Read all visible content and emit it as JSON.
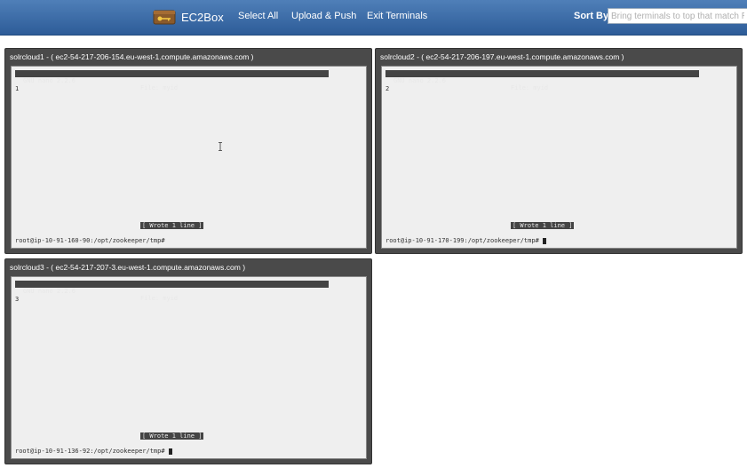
{
  "app": {
    "name": "EC2Box",
    "icon": "key-chest-icon"
  },
  "nav": {
    "select_all": "Select All",
    "upload_push": "Upload & Push",
    "exit_terminals": "Exit Terminals"
  },
  "sort": {
    "label": "Sort By",
    "placeholder": "Bring terminals to top that match Regex"
  },
  "colors": {
    "navbar": "#3a6aa6",
    "terminal_frame": "#4a4a4a",
    "terminal_screen": "#efefef"
  },
  "terminals": [
    {
      "title": "solrcloud1 - ( ec2-54-217-206-154.eu-west-1.compute.amazonaws.com )",
      "nano_version": "GNU nano 2.2.6",
      "nano_file": "File: myid",
      "content": "1",
      "status": "[ Wrote 1 line ]",
      "prompt": "root@ip-10-91-160-90:/opt/zookeeper/tmp#"
    },
    {
      "title": "solrcloud2 - ( ec2-54-217-206-197.eu-west-1.compute.amazonaws.com )",
      "nano_version": "GNU nano 2.2.6",
      "nano_file": "File: myid",
      "content": "2",
      "status": "[ Wrote 1 line ]",
      "prompt": "root@ip-10-91-170-199:/opt/zookeeper/tmp#"
    },
    {
      "title": "solrcloud3 - ( ec2-54-217-207-3.eu-west-1.compute.amazonaws.com )",
      "nano_version": "GNU nano 2.2.6",
      "nano_file": "File: myid",
      "content": "3",
      "status": "[ Wrote 1 line ]",
      "prompt": "root@ip-10-91-136-92:/opt/zookeeper/tmp#"
    }
  ]
}
